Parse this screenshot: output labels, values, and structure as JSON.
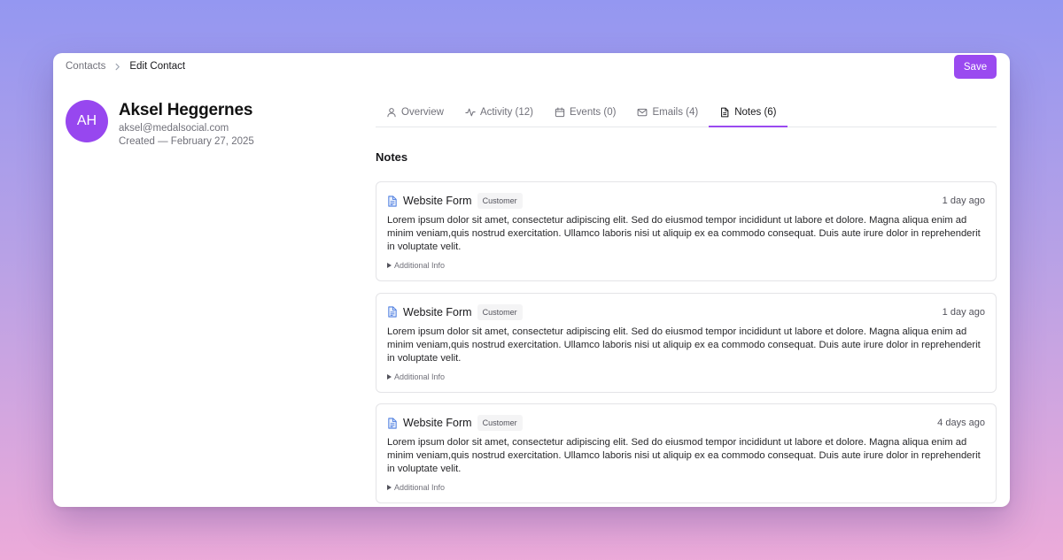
{
  "breadcrumb": {
    "parent": "Contacts",
    "current": "Edit Contact"
  },
  "toolbar": {
    "save_label": "Save"
  },
  "colors": {
    "accent": "#9a4af0",
    "avatar": "#9747ef",
    "doc_icon": "#4f7fe0"
  },
  "profile": {
    "initials": "AH",
    "name": "Aksel Heggernes",
    "email": "aksel@medalsocial.com",
    "created": "Created — February 27, 2025"
  },
  "tabs": [
    {
      "label": "Overview",
      "icon": "user-icon",
      "active": false
    },
    {
      "label": "Activity (12)",
      "icon": "activity-icon",
      "active": false
    },
    {
      "label": "Events (0)",
      "icon": "calendar-icon",
      "active": false
    },
    {
      "label": "Emails (4)",
      "icon": "mail-icon",
      "active": false
    },
    {
      "label": "Notes (6)",
      "icon": "file-text-icon",
      "active": true
    }
  ],
  "notes_section": {
    "title": "Notes",
    "items": [
      {
        "title": "Website Form",
        "badge": "Customer",
        "time": "1 day ago",
        "body": "Lorem ipsum dolor sit amet, consectetur adipiscing elit. Sed do eiusmod tempor incididunt ut labore et dolore. Magna aliqua enim ad minim veniam,quis nostrud exercitation. Ullamco laboris nisi ut aliquip ex ea commodo consequat. Duis aute irure dolor in reprehenderit in voluptate velit.",
        "more": "Additional Info"
      },
      {
        "title": "Website Form",
        "badge": "Customer",
        "time": "1 day ago",
        "body": "Lorem ipsum dolor sit amet, consectetur adipiscing elit. Sed do eiusmod tempor incididunt ut labore et dolore. Magna aliqua enim ad minim veniam,quis nostrud exercitation. Ullamco laboris nisi ut aliquip ex ea commodo consequat. Duis aute irure dolor in reprehenderit in voluptate velit.",
        "more": "Additional Info"
      },
      {
        "title": "Website Form",
        "badge": "Customer",
        "time": "4 days ago",
        "body": "Lorem ipsum dolor sit amet, consectetur adipiscing elit. Sed do eiusmod tempor incididunt ut labore et dolore. Magna aliqua enim ad minim veniam,quis nostrud exercitation. Ullamco laboris nisi ut aliquip ex ea commodo consequat. Duis aute irure dolor in reprehenderit in voluptate velit.",
        "more": "Additional Info"
      }
    ]
  }
}
